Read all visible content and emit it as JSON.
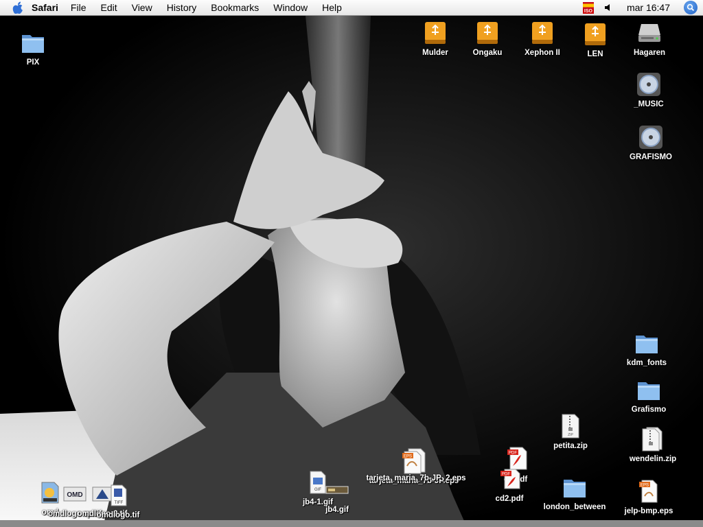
{
  "menubar": {
    "app_name": "Safari",
    "items": [
      "File",
      "Edit",
      "View",
      "History",
      "Bookmarks",
      "Window",
      "Help"
    ],
    "input_flag_label": "ISO",
    "clock": "mar 16:47"
  },
  "desktop_icons": {
    "pix": "PIX",
    "mulder": "Mulder",
    "ongaku": "Ongaku",
    "xephon": "Xephon II",
    "len": "LEN",
    "hagaren": "Hagaren",
    "music": "_MUSIC",
    "grafismo_disc": "GRAFISMO",
    "kdm_fonts": "kdm_fonts",
    "grafismo_folder": "Grafismo",
    "petita_zip": "petita.zip",
    "wendelin_zip": "wendelin.zip",
    "tarjeta_eps": "tarjeta_maria_7b-JP.eps",
    "tarjeta_eps2": "tarjeta_maria_7b-JP_2.eps",
    "cd_pdf": "cd.pdf",
    "cd2_pdf": "cd2.pdf",
    "london": "london_between",
    "jelp_eps": "jelp-bmp.eps",
    "jb4_gif": "jb4.gif",
    "jb4_1_gif": "jb4-1.gif",
    "omd": "omd",
    "omdlogo_tif": "omdlogo.tif",
    "omdlogo_rp_tif": "omdlogo-rp.tif",
    "omdlogo2_tif": "omdlogo-2.tif"
  },
  "icon_badges": {
    "zip": "ZIP",
    "eps": "EPS",
    "pdf": "PDF",
    "gif": "GIF",
    "tiff": "TIFF"
  },
  "colors": {
    "menubar_bg": "#ececec",
    "usb_drive": "#f0a020",
    "folder_blue": "#7fb2e8",
    "label_text": "#ffffff"
  }
}
